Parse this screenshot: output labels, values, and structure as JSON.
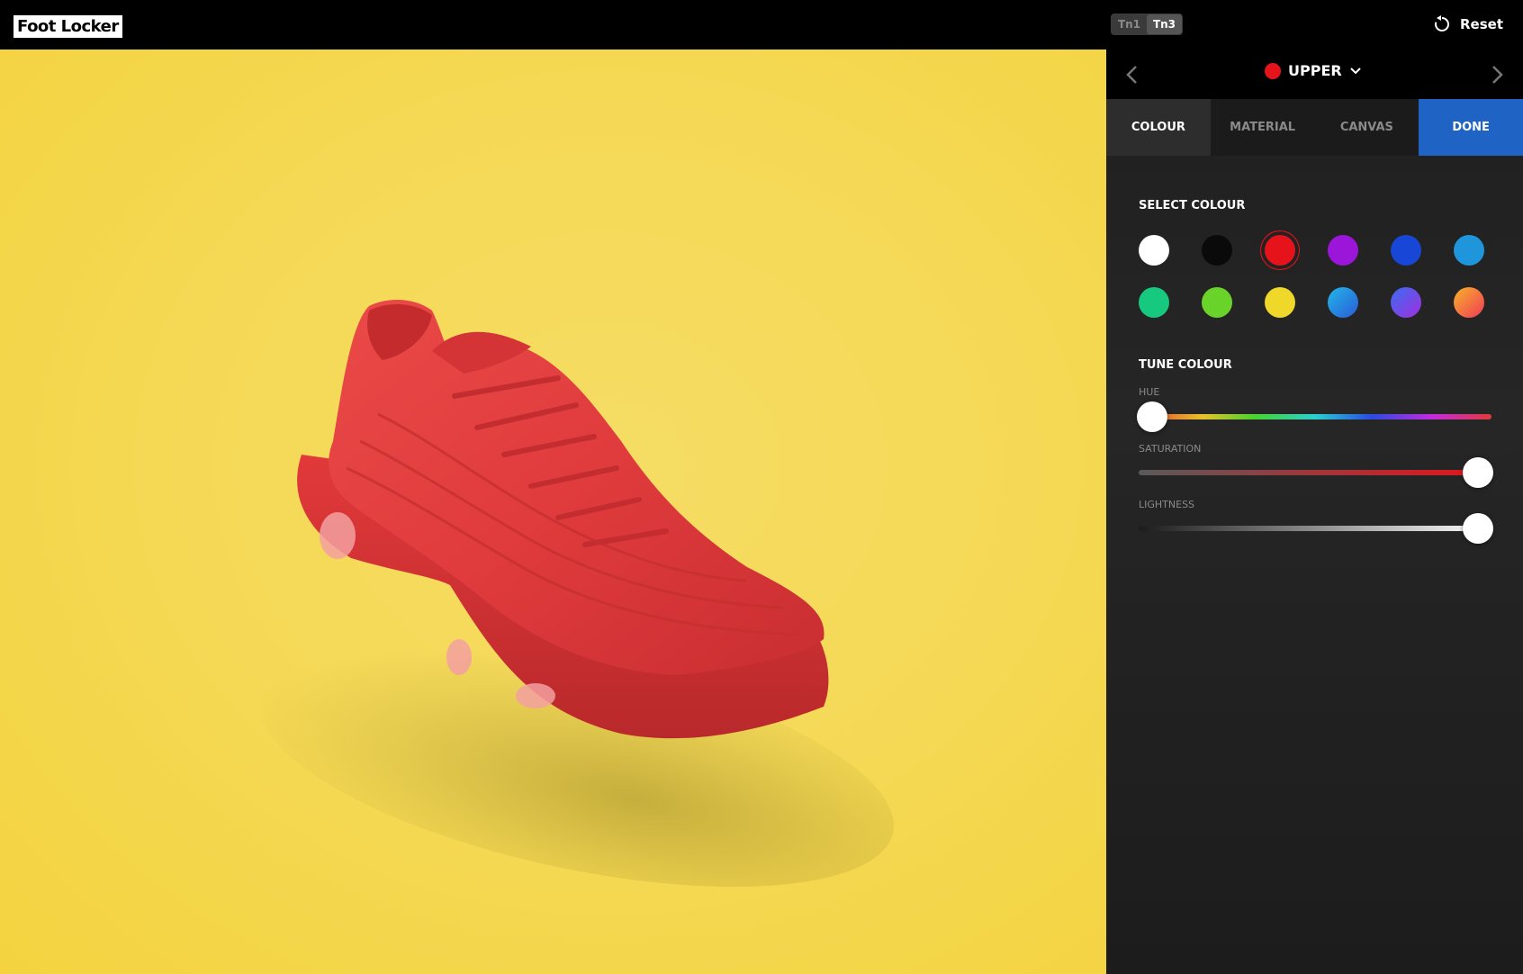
{
  "brand": {
    "logo_text": "Foot Locker"
  },
  "models": [
    {
      "label": "Tn1",
      "active": false
    },
    {
      "label": "Tn3",
      "active": true
    }
  ],
  "header": {
    "reset_label": "Reset"
  },
  "part_selector": {
    "label": "UPPER",
    "color": "#e6131b"
  },
  "tabs": [
    {
      "label": "COLOUR",
      "active": true
    },
    {
      "label": "MATERIAL",
      "active": false
    },
    {
      "label": "CANVAS",
      "active": false
    },
    {
      "label": "DONE",
      "primary": true
    }
  ],
  "select_colour": {
    "title": "SELECT COLOUR",
    "swatches": [
      {
        "name": "white",
        "color": "#ffffff"
      },
      {
        "name": "black",
        "color": "#0a0a0a"
      },
      {
        "name": "red",
        "color": "#e6131b",
        "selected": true
      },
      {
        "name": "purple",
        "color": "#9b16d8"
      },
      {
        "name": "blue",
        "color": "#1846d6"
      },
      {
        "name": "sky-blue",
        "color": "#1f95dc"
      },
      {
        "name": "green",
        "color": "#17c97f"
      },
      {
        "name": "lime",
        "color": "#6ad32a"
      },
      {
        "name": "yellow",
        "color": "#f0d82a"
      },
      {
        "name": "blue-gradient",
        "color": "#2a86e0"
      },
      {
        "name": "purple-gradient",
        "color": "#6a55e6"
      },
      {
        "name": "orange-gradient",
        "color": "#f27a2a"
      }
    ]
  },
  "tune_colour": {
    "title": "TUNE COLOUR",
    "hue_label": "HUE",
    "hue_value": 0.0,
    "saturation_label": "SATURATION",
    "saturation_value": 1.0,
    "lightness_label": "LIGHTNESS",
    "lightness_value": 1.0
  },
  "viewer": {
    "background": "#f4d33f",
    "shoe_color": "#e23d3f"
  }
}
